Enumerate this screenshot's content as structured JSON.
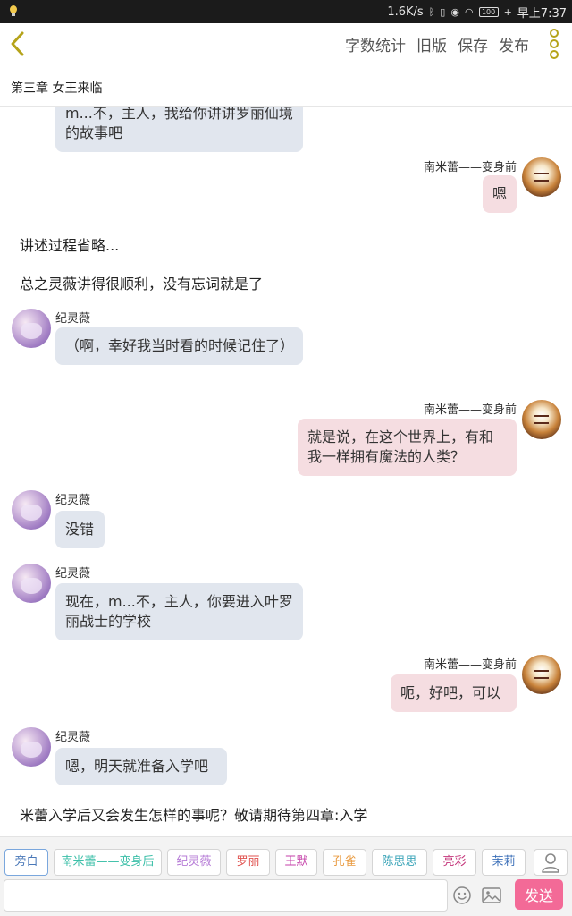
{
  "status_bar": {
    "speed": "1.6K/s",
    "battery": "100",
    "time": "早上7:37"
  },
  "toolbar": {
    "actions": [
      "字数统计",
      "旧版",
      "保存",
      "发布"
    ]
  },
  "chapter": {
    "title": "第三章 女王来临"
  },
  "chat": {
    "messages": [
      {
        "text": "m...不，主人，我给你讲讲罗丽仙境的故事吧"
      },
      {
        "name": "南米蕾——变身前",
        "text": "嗯"
      },
      {
        "text": "讲述过程省略..."
      },
      {
        "text": "总之灵薇讲得很顺利，没有忘词就是了"
      },
      {
        "name": "纪灵薇",
        "text": "（啊，幸好我当时看的时候记住了）"
      },
      {
        "name": "南米蕾——变身前",
        "text": "就是说，在这个世界上，有和我一样拥有魔法的人类？"
      },
      {
        "name": "纪灵薇",
        "text": "没错"
      },
      {
        "name": "纪灵薇",
        "text": "现在，m...不，主人，你要进入叶罗丽战士的学校"
      },
      {
        "name": "南米蕾——变身前",
        "text": "呃，好吧，可以"
      },
      {
        "name": "纪灵薇",
        "text": "嗯，明天就准备入学吧"
      },
      {
        "text": "米蕾入学后又会发生怎样的事呢？敬请期待第四章:入学"
      }
    ]
  },
  "characters": [
    {
      "label": "旁白",
      "color": "#4a78b8"
    },
    {
      "label": "南米蕾——变身后",
      "color": "#3bbfa8"
    },
    {
      "label": "纪灵薇",
      "color": "#b57ad6"
    },
    {
      "label": "罗丽",
      "color": "#e0524f"
    },
    {
      "label": "王默",
      "color": "#c43fa8"
    },
    {
      "label": "孔雀",
      "color": "#e99a3f"
    },
    {
      "label": "陈思思",
      "color": "#3aa4b8"
    },
    {
      "label": "亮彩",
      "color": "#c4357a"
    },
    {
      "label": "茉莉",
      "color": "#3b6fb8"
    }
  ],
  "input": {
    "placeholder": "",
    "send_label": "发送"
  }
}
